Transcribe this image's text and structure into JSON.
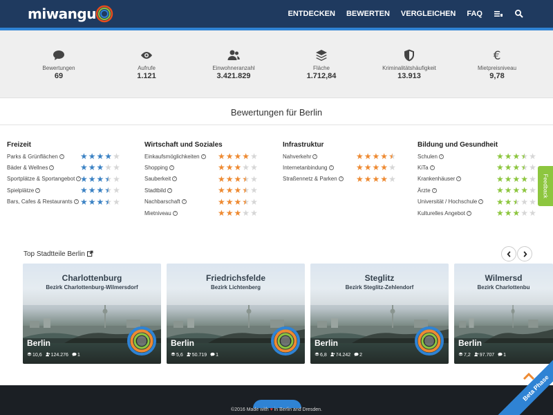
{
  "header": {
    "logo": "miwangu",
    "nav": [
      "ENTDECKEN",
      "BEWERTEN",
      "VERGLEICHEN",
      "FAQ"
    ],
    "icons": [
      "list-icon",
      "search-icon"
    ]
  },
  "stats": [
    {
      "icon": "comment-icon",
      "label": "Bewertungen",
      "value": "69"
    },
    {
      "icon": "eye-icon",
      "label": "Aufrufe",
      "value": "1.121"
    },
    {
      "icon": "users-icon",
      "label": "Einwohneranzahl",
      "value": "3.421.829"
    },
    {
      "icon": "layers-icon",
      "label": "Fläche",
      "value": "1.712,84"
    },
    {
      "icon": "shield-icon",
      "label": "Kriminalitätshäufigkeit",
      "value": "13.913"
    },
    {
      "icon": "euro-icon",
      "label": "Mietpreisniveau",
      "value": "9,78"
    }
  ],
  "section_title": "Bewertungen für Berlin",
  "categories": [
    {
      "title": "Freizeit",
      "color": "#3b82c4",
      "items": [
        {
          "label": "Parks & Grünflächen",
          "rating": 4
        },
        {
          "label": "Bäder & Wellnes",
          "rating": 3
        },
        {
          "label": "Sportplätze & Sportangebot",
          "rating": 3.5
        },
        {
          "label": "Spielplätze",
          "rating": 3.5
        },
        {
          "label": "Bars, Cafes & Restaurants",
          "rating": 3.5
        }
      ]
    },
    {
      "title": "Wirtschaft und Soziales",
      "color": "#ee8a32",
      "items": [
        {
          "label": "Einkaufsmöglichkeiten",
          "rating": 4
        },
        {
          "label": "Shopping",
          "rating": 3
        },
        {
          "label": "Sauberkeit",
          "rating": 3.5
        },
        {
          "label": "Stadtbild",
          "rating": 3.5
        },
        {
          "label": "Nachbarschaft",
          "rating": 3.5
        },
        {
          "label": "Mietniveau",
          "rating": 3
        }
      ]
    },
    {
      "title": "Infrastruktur",
      "color": "#ee8a32",
      "items": [
        {
          "label": "Nahverkehr",
          "rating": 4.5
        },
        {
          "label": "Internetanbindung",
          "rating": 4
        },
        {
          "label": "Straßennetz & Parken",
          "rating": 4
        }
      ]
    },
    {
      "title": "Bildung und Gesundheit",
      "color": "#8dc63f",
      "items": [
        {
          "label": "Schulen",
          "rating": 3.5
        },
        {
          "label": "KiTa",
          "rating": 3.5
        },
        {
          "label": "Krankenhäuser",
          "rating": 4
        },
        {
          "label": "Ärzte",
          "rating": 4
        },
        {
          "label": "Universität / Hochschule",
          "rating": 2.5
        },
        {
          "label": "Kulturelles Angebot",
          "rating": 3
        }
      ]
    }
  ],
  "feedback_label": "Feedback",
  "top": {
    "title": "Top Stadtteile Berlin",
    "cards": [
      {
        "name": "Charlottenburg",
        "district": "Bezirk Charlottenburg-Wilmersdorf",
        "city": "Berlin",
        "area": "10,6",
        "pop": "124.276",
        "comments": "1"
      },
      {
        "name": "Friedrichsfelde",
        "district": "Bezirk Lichtenberg",
        "city": "Berlin",
        "area": "5,6",
        "pop": "50.719",
        "comments": "1"
      },
      {
        "name": "Steglitz",
        "district": "Bezirk Steglitz-Zehlendorf",
        "city": "Berlin",
        "area": "6,8",
        "pop": "74.242",
        "comments": "2"
      },
      {
        "name": "Wilmersd",
        "district": "Bezirk Charlottenbu",
        "city": "Berlin",
        "area": "7,2",
        "pop": "97.707",
        "comments": "1"
      }
    ]
  },
  "footer": {
    "prefix": "©2016 Made with",
    "suffix": "in Berlin and Dresden."
  },
  "beta_label": "Beta Phase"
}
